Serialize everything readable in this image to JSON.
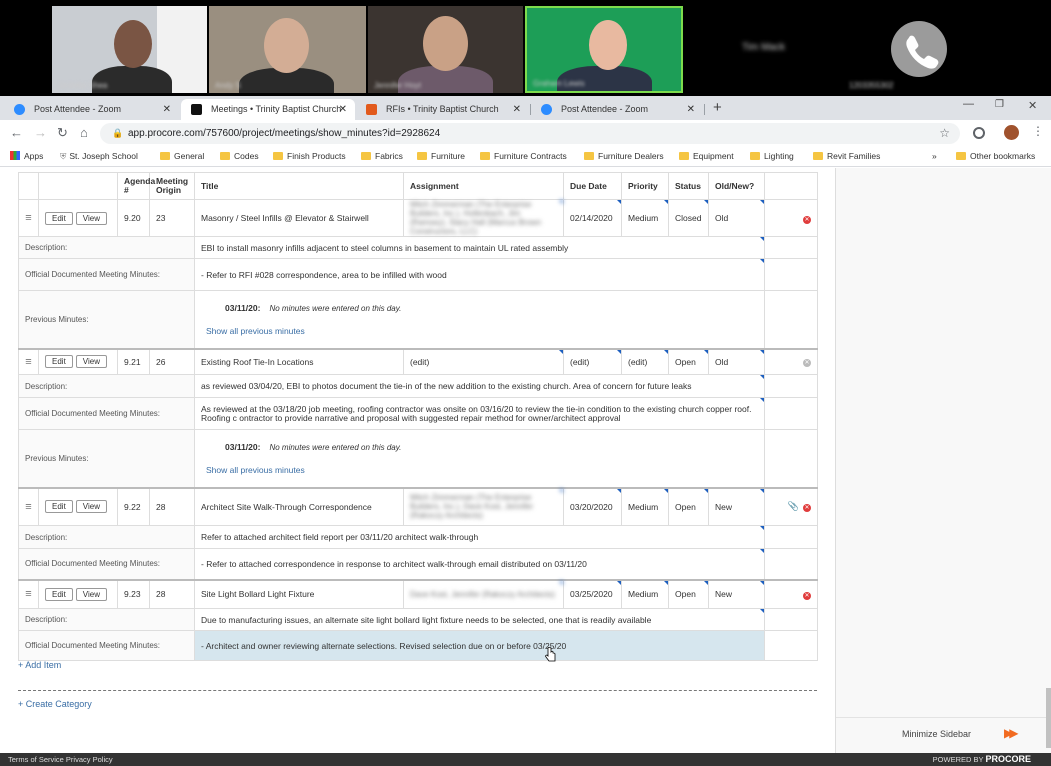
{
  "participants": [
    {
      "name": "Jennifer Shea"
    },
    {
      "name": "Andy S"
    },
    {
      "name": "Jennifer Hoyt"
    },
    {
      "name": "Graham Lewis"
    },
    {
      "name": "Tim Mack"
    },
    {
      "name": "1203355302"
    }
  ],
  "tabs": [
    "Post Attendee - Zoom",
    "Meetings • Trinity Baptist Church",
    "RFIs • Trinity Baptist Church",
    "Post Attendee - Zoom"
  ],
  "url": "app.procore.com/757600/project/meetings/show_minutes?id=2928624",
  "bookmarks": [
    "Apps",
    "St. Joseph School",
    "General",
    "Codes",
    "Finish Products",
    "Fabrics",
    "Furniture",
    "Furniture Contracts",
    "Furniture Dealers",
    "Equipment",
    "Lighting",
    "Revit Families",
    "»",
    "Other bookmarks"
  ],
  "headers": [
    "Agenda #",
    "Meeting Origin",
    "Title",
    "Assignment",
    "Due Date",
    "Priority",
    "Status",
    "Old/New?"
  ],
  "labels": {
    "edit": "Edit",
    "view": "View",
    "description": "Description:",
    "official": "Official Documented Meeting Minutes:",
    "previous": "Previous Minutes:",
    "prev_date": "03/11/20:",
    "no_min": "No minutes were entered on this day.",
    "show_all": "Show all previous minutes",
    "add_item": "+ Add Item",
    "create_cat": "+ Create Category"
  },
  "items": [
    {
      "agenda": "9.20",
      "origin": "23",
      "title": "Masonry / Steel Infills @ Elevator & Stairwell",
      "assignment": "Mitch Zimmerman (The Enterprise Builders, Inc.), Hollenbach, Jim (Ramsey), Stacy Hall (Marcus Brown Constructors, LLC)",
      "due": "02/14/2020",
      "priority": "Medium",
      "status": "Closed",
      "oldnew": "Old",
      "description": "EBI to install masonry infills adjacent to steel columns in basement to maintain UL rated assembly",
      "minutes": "- Refer to RFI #028 correspondence, area to be infilled with wood"
    },
    {
      "agenda": "9.21",
      "origin": "26",
      "title": "Existing Roof Tie-In Locations",
      "assignment": "(edit)",
      "due": "(edit)",
      "priority": "(edit)",
      "status": "Open",
      "oldnew": "Old",
      "description": "as reviewed 03/04/20, EBI to photos document the tie-in of the new addition to the existing church. Area of concern for future leaks",
      "minutes": "As reviewed at the 03/18/20 job meeting, roofing contractor was onsite on 03/16/20 to review the tie-in condition to the existing church copper roof. Roofing c ontractor to provide narrative and proposal with suggested repair method for owner/architect approval"
    },
    {
      "agenda": "9.22",
      "origin": "28",
      "title": "Architect Site Walk-Through Correspondence",
      "assignment": "Mitch Zimmerman (The Enterprise Builders, Inc.), Dave Kost, Jennifer (Rakoczy Architects)",
      "due": "03/20/2020",
      "priority": "Medium",
      "status": "Open",
      "oldnew": "New",
      "description": "Refer to attached architect field report per 03/11/20 architect walk-through",
      "minutes": "- Refer to attached correspondence in response to architect walk-through email distributed on 03/11/20"
    },
    {
      "agenda": "9.23",
      "origin": "28",
      "title": "Site Light Bollard Light Fixture",
      "assignment": "Dave Kost, Jennifer (Rakoczy Architects)",
      "due": "03/25/2020",
      "priority": "Medium",
      "status": "Open",
      "oldnew": "New",
      "description": "Due to manufacturing issues, an alternate site light bollard light fixture needs to be selected, one that is readily available",
      "minutes": "- Architect and owner reviewing alternate selections. Revised selection due on or before 03/25/20"
    }
  ],
  "sidebar": {
    "minimize": "Minimize Sidebar"
  },
  "footer": {
    "left": "Terms of Service  Privacy Policy",
    "right_prefix": "POWERED BY",
    "brand": "PROCORE"
  }
}
